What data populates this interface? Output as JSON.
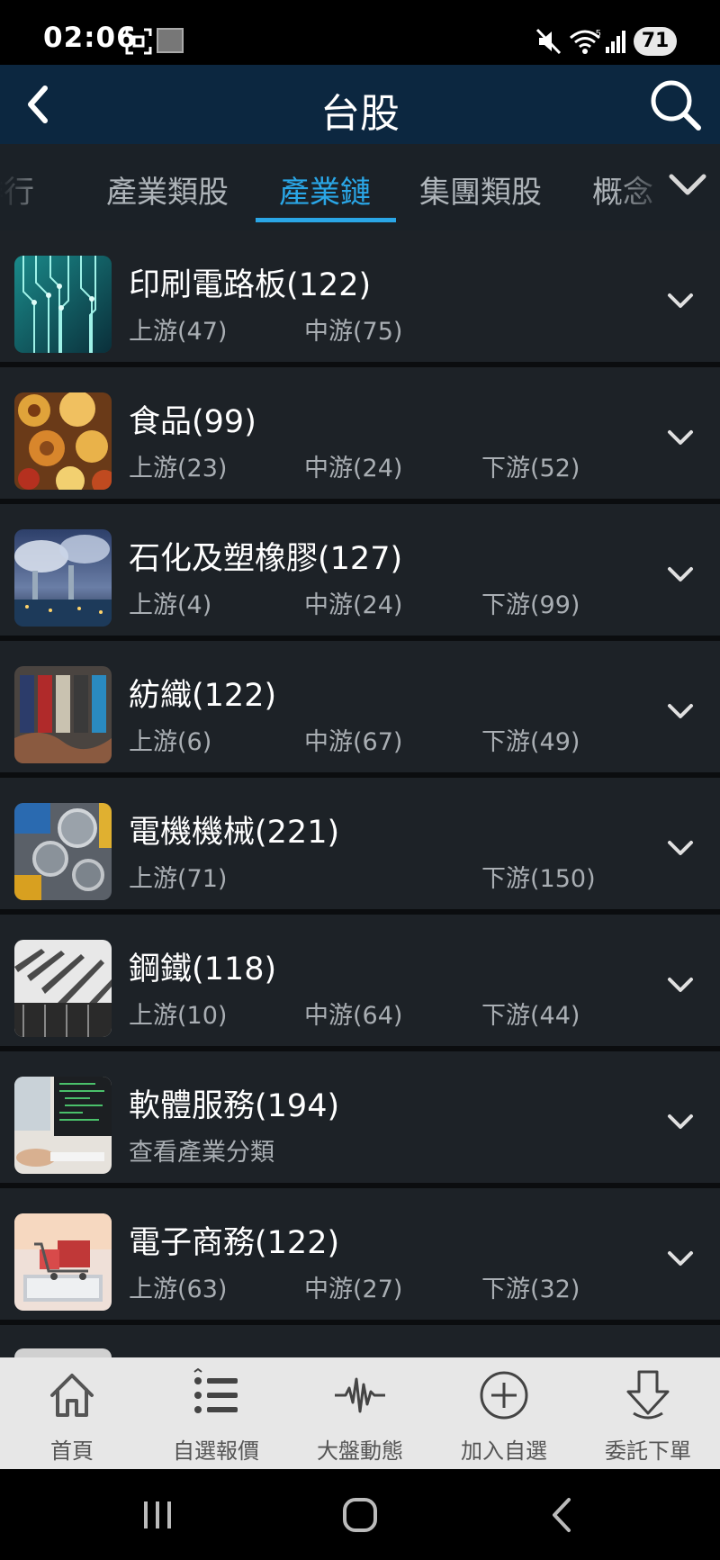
{
  "status_bar": {
    "time": "02:06",
    "battery": "71"
  },
  "header": {
    "title": "台股"
  },
  "tabs": [
    {
      "label": "排行",
      "active": false
    },
    {
      "label": "產業類股",
      "active": false
    },
    {
      "label": "產業鏈",
      "active": true
    },
    {
      "label": "集團類股",
      "active": false
    },
    {
      "label": "概念",
      "active": false
    }
  ],
  "industries": [
    {
      "title": "印刷電路板(122)",
      "upstream": "上游(47)",
      "midstream": "中游(75)",
      "downstream": ""
    },
    {
      "title": "食品(99)",
      "upstream": "上游(23)",
      "midstream": "中游(24)",
      "downstream": "下游(52)"
    },
    {
      "title": "石化及塑橡膠(127)",
      "upstream": "上游(4)",
      "midstream": "中游(24)",
      "downstream": "下游(99)"
    },
    {
      "title": "紡織(122)",
      "upstream": "上游(6)",
      "midstream": "中游(67)",
      "downstream": "下游(49)"
    },
    {
      "title": "電機機械(221)",
      "upstream": "上游(71)",
      "midstream": "",
      "downstream": "下游(150)"
    },
    {
      "title": "鋼鐵(118)",
      "upstream": "上游(10)",
      "midstream": "中游(64)",
      "downstream": "下游(44)"
    },
    {
      "title": "軟體服務(194)",
      "upstream": "查看產業分類",
      "midstream": "",
      "downstream": ""
    },
    {
      "title": "電子商務(122)",
      "upstream": "上游(63)",
      "midstream": "中游(27)",
      "downstream": "下游(32)"
    }
  ],
  "bottom_nav": [
    {
      "label": "首頁",
      "icon": "home-icon"
    },
    {
      "label": "自選報價",
      "icon": "list-icon"
    },
    {
      "label": "大盤動態",
      "icon": "pulse-icon"
    },
    {
      "label": "加入自選",
      "icon": "add-circle-icon"
    },
    {
      "label": "委託下單",
      "icon": "order-down-icon"
    }
  ],
  "colors": {
    "accent": "#2aa6e6",
    "header_bg": "#0c2740",
    "card_bg": "#1d2227"
  }
}
